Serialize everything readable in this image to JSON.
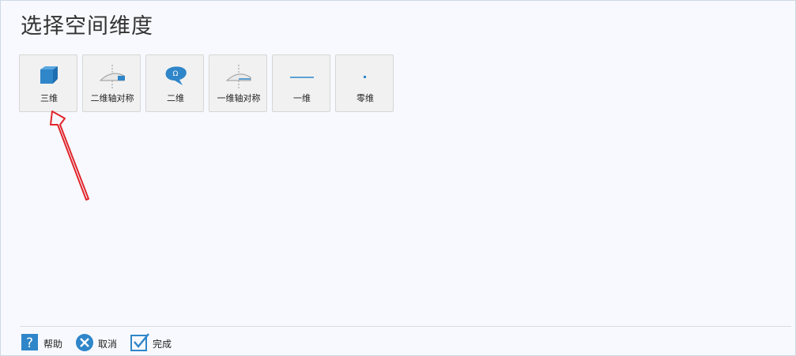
{
  "title": "选择空间维度",
  "dimensions": [
    {
      "label": "三维",
      "icon": "cube-icon"
    },
    {
      "label": "二维轴对称",
      "icon": "axisymmetric-2d-icon"
    },
    {
      "label": "二维",
      "icon": "planar-2d-icon"
    },
    {
      "label": "一维轴对称",
      "icon": "axisymmetric-1d-icon"
    },
    {
      "label": "一维",
      "icon": "line-1d-icon"
    },
    {
      "label": "零维",
      "icon": "point-0d-icon"
    }
  ],
  "footer": {
    "help_label": "帮助",
    "cancel_label": "取消",
    "done_label": "完成"
  },
  "colors": {
    "accent": "#2f86c9",
    "annotation_arrow": "#e0262b"
  }
}
